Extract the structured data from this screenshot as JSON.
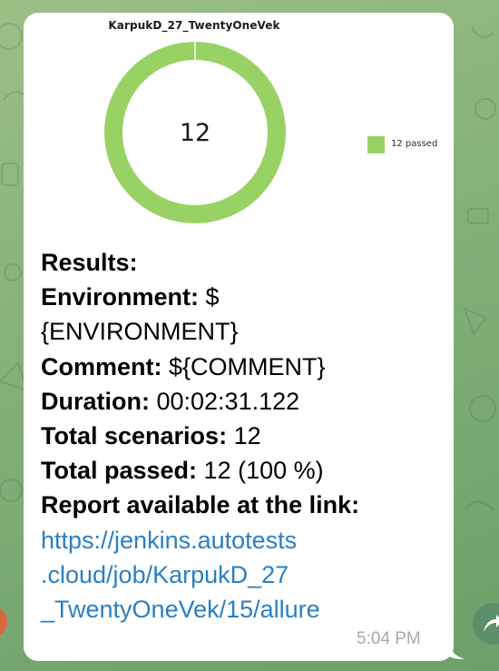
{
  "chart": {
    "title": "KarpukD_27_TwentyOneVek",
    "center_value": "12",
    "legend_label": "12 passed",
    "passed_color": "#98d264"
  },
  "chart_data": {
    "type": "pie",
    "title": "KarpukD_27_TwentyOneVek",
    "categories": [
      "passed"
    ],
    "values": [
      12
    ],
    "center_label": "12",
    "legend": [
      "12 passed"
    ],
    "legend_position": "right",
    "colors": [
      "#98d264"
    ]
  },
  "message": {
    "results_label": "Results:",
    "environment_label": "Environment:",
    "environment_value_1": " $",
    "environment_value_2": "{ENVIRONMENT}",
    "comment_label": "Comment:",
    "comment_value": " ${COMMENT}",
    "duration_label": "Duration:",
    "duration_value": " 00:02:31.122",
    "scenarios_label": "Total scenarios:",
    "scenarios_value": " 12",
    "passed_label": "Total passed:",
    "passed_value": " 12 (100 %)",
    "report_label": "Report available at the link:",
    "link_line_1": "https://jenkins.autotests",
    "link_line_2": ".cloud/job/KarpukD_27",
    "link_line_3": "_TwentyOneVek/15/allure",
    "time": "5:04 PM"
  },
  "icons": {
    "share": "share-arrow-icon"
  },
  "colors": {
    "link": "#2a7fc1",
    "bubble": "#ffffff",
    "timestamp": "#a9a9a9"
  }
}
